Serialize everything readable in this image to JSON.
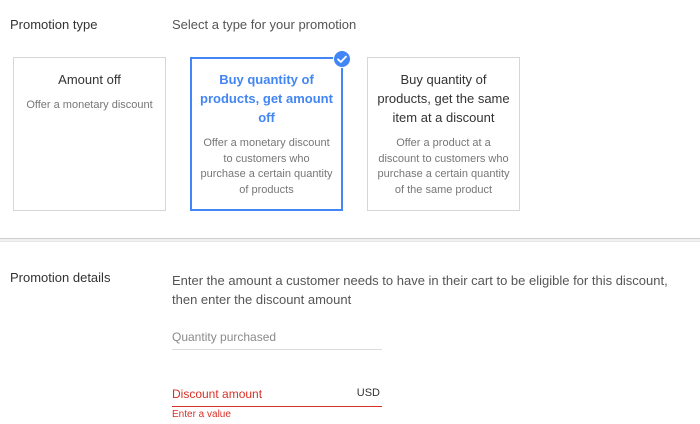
{
  "promotion_type": {
    "label": "Promotion type",
    "prompt": "Select a type for your promotion",
    "cards": [
      {
        "title": "Amount off",
        "description": "Offer a monetary discount",
        "selected": false
      },
      {
        "title": "Buy quantity of products, get amount off",
        "description": "Offer a monetary discount to customers who purchase a certain quantity of products",
        "selected": true
      },
      {
        "title": "Buy quantity of products, get the same item at a discount",
        "description": "Offer a product at a discount to customers who purchase a certain quantity of the same product",
        "selected": false
      }
    ],
    "accent_color": "#4285f4"
  },
  "promotion_details": {
    "label": "Promotion details",
    "description": "Enter the amount a customer needs to have in their cart to be eligible for this discount, then enter the discount amount",
    "quantity_field": {
      "label": "Quantity purchased",
      "value": ""
    },
    "discount_field": {
      "label": "Discount amount",
      "unit": "USD",
      "value": "",
      "error": "Enter a value"
    },
    "error_color": "#d93025"
  }
}
